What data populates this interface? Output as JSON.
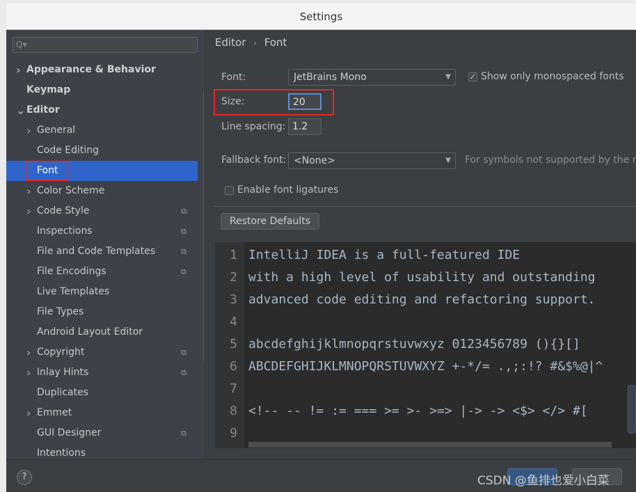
{
  "window": {
    "title": "Settings"
  },
  "sidebar": {
    "search_placeholder": "Q▾",
    "items": [
      {
        "label": "Appearance & Behavior",
        "level": 0,
        "bold": true,
        "chevron": "right"
      },
      {
        "label": "Keymap",
        "level": 0,
        "bold": true
      },
      {
        "label": "Editor",
        "level": 0,
        "bold": true,
        "chevron": "down"
      },
      {
        "label": "General",
        "level": 1,
        "chevron": "right"
      },
      {
        "label": "Code Editing",
        "level": 1
      },
      {
        "label": "Font",
        "level": 1,
        "selected": true
      },
      {
        "label": "Color Scheme",
        "level": 1,
        "chevron": "right"
      },
      {
        "label": "Code Style",
        "level": 1,
        "chevron": "right",
        "copy": true
      },
      {
        "label": "Inspections",
        "level": 1,
        "copy": true
      },
      {
        "label": "File and Code Templates",
        "level": 1,
        "copy": true
      },
      {
        "label": "File Encodings",
        "level": 1,
        "copy": true
      },
      {
        "label": "Live Templates",
        "level": 1
      },
      {
        "label": "File Types",
        "level": 1
      },
      {
        "label": "Android Layout Editor",
        "level": 1
      },
      {
        "label": "Copyright",
        "level": 1,
        "chevron": "right",
        "copy": true
      },
      {
        "label": "Inlay Hints",
        "level": 1,
        "chevron": "right",
        "copy": true
      },
      {
        "label": "Duplicates",
        "level": 1
      },
      {
        "label": "Emmet",
        "level": 1,
        "chevron": "right"
      },
      {
        "label": "GUI Designer",
        "level": 1,
        "copy": true
      },
      {
        "label": "Intentions",
        "level": 1
      }
    ]
  },
  "breadcrumb": {
    "parent": "Editor",
    "sep": "›",
    "current": "Font"
  },
  "form": {
    "font_label": "Font:",
    "font_value": "JetBrains Mono",
    "mono_label": "Show only monospaced fonts",
    "mono_checked": true,
    "size_label": "Size:",
    "size_value": "20",
    "spacing_label": "Line spacing:",
    "spacing_value": "1.2",
    "fallback_label": "Fallback font:",
    "fallback_value": "<None>",
    "fallback_hint": "For symbols not supported by the m",
    "ligatures_label": "Enable font ligatures",
    "ligatures_checked": false,
    "restore_label": "Restore Defaults"
  },
  "preview": {
    "lines": [
      "IntelliJ IDEA is a full-featured IDE",
      "with a high level of usability and outstanding",
      "advanced code editing and refactoring support.",
      "",
      "abcdefghijklmnopqrstuvwxyz 0123456789 (){}[]",
      "ABCDEFGHIJKLMNOPQRSTUVWXYZ +-*/= .,;:!? #&$%@|^",
      "",
      "<!-- -- != := === >= >- >=> |-> -> <$> </> #[",
      ""
    ]
  },
  "footer": {
    "help": "?",
    "watermark": "CSDN @鱼排也爱小白菜"
  },
  "colors": {
    "selection": "#2f65ca",
    "highlight": "#e8262a"
  }
}
